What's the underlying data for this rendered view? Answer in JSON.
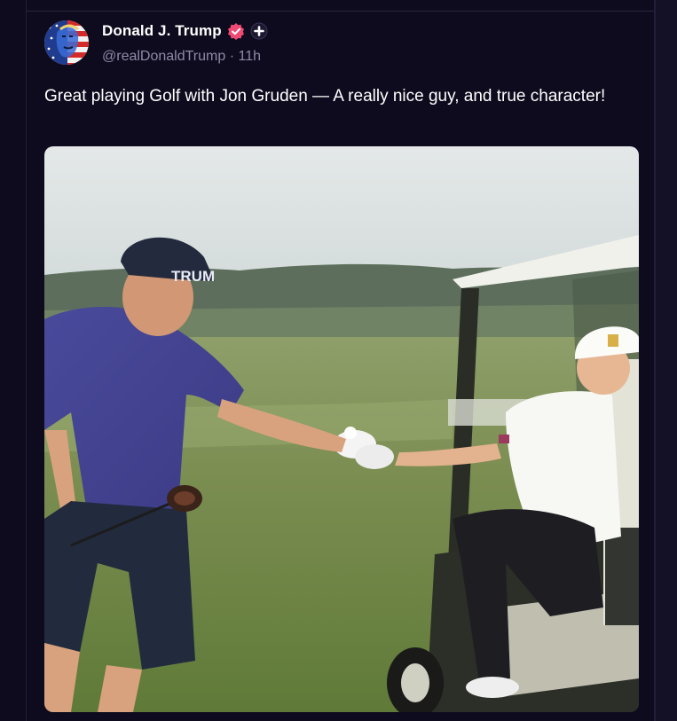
{
  "post": {
    "author": {
      "display_name": "Donald J. Trump",
      "handle": "@realDonaldTrump",
      "time_ago": "11h",
      "separator": "·",
      "avatar_icon": "avatar-flag-portrait",
      "badges": [
        "verified-badge-icon",
        "plus-badge-icon"
      ]
    },
    "text": "Great playing Golf with Jon Gruden — A really nice guy, and true character!",
    "media": {
      "type": "photo",
      "hat_text": "TRUM"
    }
  },
  "colors": {
    "background": "#0e0b1e",
    "text_primary": "#ffffff",
    "text_secondary": "#8f8aa8",
    "verified_badge": "#ef4a74",
    "divider": "#231f38"
  }
}
